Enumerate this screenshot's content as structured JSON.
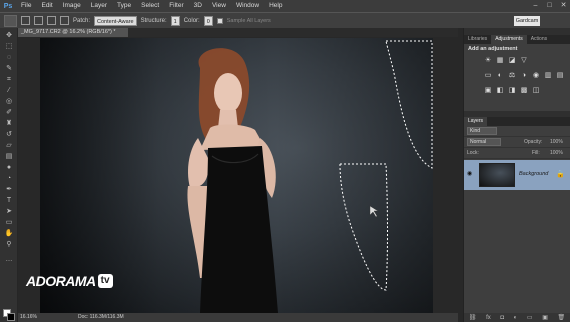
{
  "app": {
    "logo": "Ps"
  },
  "menu": [
    "File",
    "Edit",
    "Image",
    "Layer",
    "Type",
    "Select",
    "Filter",
    "3D",
    "View",
    "Window",
    "Help"
  ],
  "options": {
    "patch_label": "Patch:",
    "patch_value": "Content-Aware",
    "structure_label": "Structure:",
    "structure_value": "1",
    "color_label": "Color:",
    "color_value": "0",
    "sample_all": "Sample All Layers",
    "workspace": "Gardcam"
  },
  "document": {
    "tab_title": "_MG_9717.CR2 @ 16.2% (RGB/16*) *"
  },
  "status": {
    "zoom": "16.16%",
    "doc": "Doc: 116.3M/116.3M"
  },
  "panels": {
    "top_tabs": [
      "Libraries",
      "Adjustments",
      "Actions"
    ],
    "adjustments_title": "Add an adjustment",
    "adjustment_icons": [
      "☀",
      "▦",
      "◪",
      "▽",
      "▭",
      "◐",
      "⚖",
      "◑",
      "◉",
      "▥",
      "▤",
      "▣",
      "◧",
      "◨",
      "▩",
      "◫"
    ],
    "layers_tabs": [
      "Layers"
    ],
    "kind_label": "Kind",
    "blend_mode": "Normal",
    "opacity_label": "Opacity:",
    "opacity_value": "100%",
    "lock_label": "Lock:",
    "fill_label": "Fill:",
    "fill_value": "100%",
    "layer_name": "Background"
  },
  "watermark": {
    "brand": "ADORAMA",
    "tv": "tv"
  },
  "colors": {
    "foreground": "#ffffff",
    "background": "#000000",
    "selected_layer": "#8aa2bf"
  }
}
